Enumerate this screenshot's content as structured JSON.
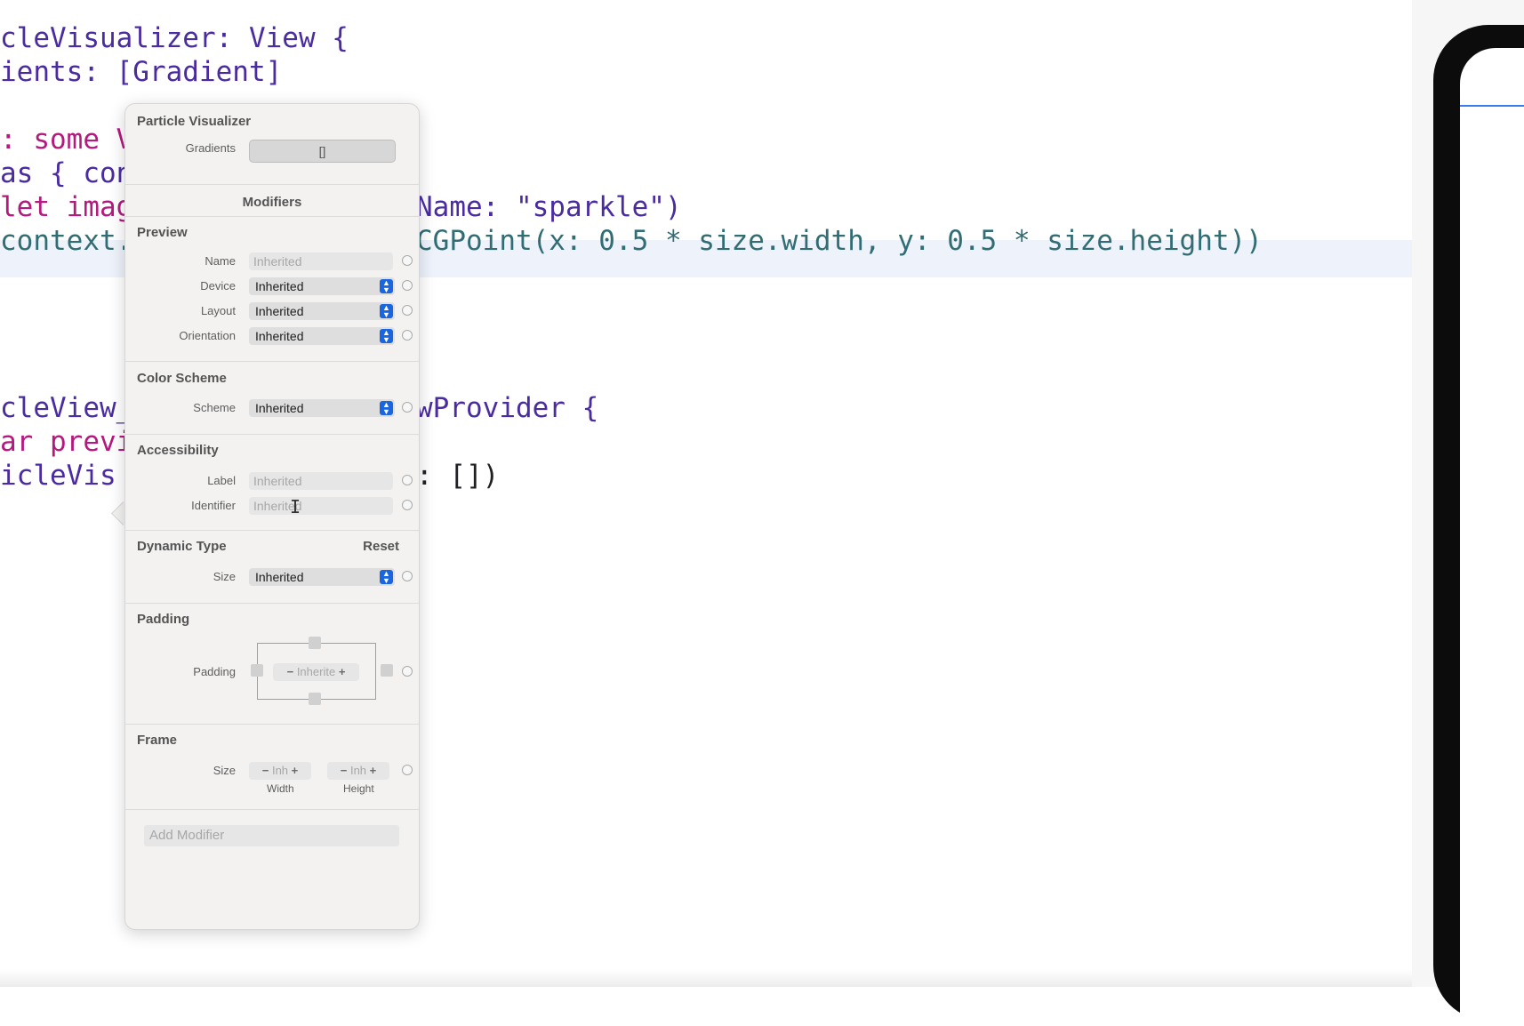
{
  "editor": {
    "code_lines": [
      "cleVisualizer: View {",
      "ients: [Gradient]",
      ": some V",
      "as { con",
      "let imag",
      "context.",
      "cleView_",
      "ar previ",
      "icleVis",
      "Name: \"sparkle\")",
      "CGPoint(x: 0.5 * size.width, y: 0.5 * size.height))",
      "wProvider {",
      ": [])"
    ]
  },
  "inspector": {
    "title": "Particle Visualizer",
    "gradients_label": "Gradients",
    "gradients_value": "[]",
    "modifiers_header": "Modifiers",
    "preview": {
      "title": "Preview",
      "name_label": "Name",
      "name_placeholder": "Inherited",
      "device_label": "Device",
      "device_value": "Inherited",
      "layout_label": "Layout",
      "layout_value": "Inherited",
      "orientation_label": "Orientation",
      "orientation_value": "Inherited"
    },
    "color_scheme": {
      "title": "Color Scheme",
      "scheme_label": "Scheme",
      "scheme_value": "Inherited"
    },
    "accessibility": {
      "title": "Accessibility",
      "label_label": "Label",
      "label_placeholder": "Inherited",
      "identifier_label": "Identifier",
      "identifier_placeholder": "Inherited"
    },
    "dynamic_type": {
      "title": "Dynamic Type",
      "reset_label": "Reset",
      "size_label": "Size",
      "size_value": "Inherited"
    },
    "padding": {
      "title": "Padding",
      "padding_label": "Padding",
      "stepper_value": "Inherite",
      "minus": "−",
      "plus": "+"
    },
    "frame": {
      "title": "Frame",
      "size_label": "Size",
      "width_value": "Inh",
      "height_value": "Inh",
      "width_caption": "Width",
      "height_caption": "Height",
      "minus": "−",
      "plus": "+"
    },
    "add_modifier_placeholder": "Add Modifier"
  },
  "colors": {
    "keyword": "#b4197e",
    "string": "#c41a16",
    "number": "#1c00cf",
    "accent": "#1a66e0",
    "highlight_line": "#eef2fb"
  },
  "icons": {
    "popup": "chevron-up-down-icon",
    "cursor": "text-cursor-icon"
  }
}
